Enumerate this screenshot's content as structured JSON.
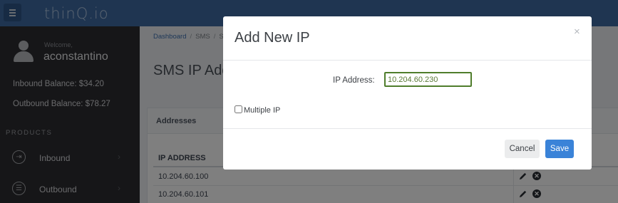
{
  "header": {
    "logo_text": "thinQ.io"
  },
  "sidebar": {
    "welcome": "Welcome,",
    "username": "aconstantino",
    "inbound_balance": "Inbound Balance: $34.20",
    "outbound_balance": "Outbound Balance: $78.27",
    "products_heading": "PRODUCTS",
    "items": [
      {
        "label": "Inbound",
        "icon": "inbound-icon"
      },
      {
        "label": "Outbound",
        "icon": "outbound-icon"
      }
    ]
  },
  "main": {
    "breadcrumb": [
      "Dashboard",
      "SMS",
      "S"
    ],
    "page_title": "SMS IP Add",
    "panel_title": "Addresses",
    "table": {
      "header": "IP ADDRESS",
      "rows": [
        "10.204.60.100",
        "10.204.60.101"
      ]
    }
  },
  "modal": {
    "title": "Add New IP",
    "close_glyph": "×",
    "ip_label": "IP Address:",
    "ip_value": "10.204.60.230",
    "multiple_label": "Multiple IP",
    "multiple_checked": false,
    "cancel_label": "Cancel",
    "save_label": "Save"
  },
  "colors": {
    "topbar": "#3e6aa2",
    "sidebar": "#2c2d31",
    "save_button": "#3a83d8",
    "input_focus_border": "#4f7d2c"
  }
}
